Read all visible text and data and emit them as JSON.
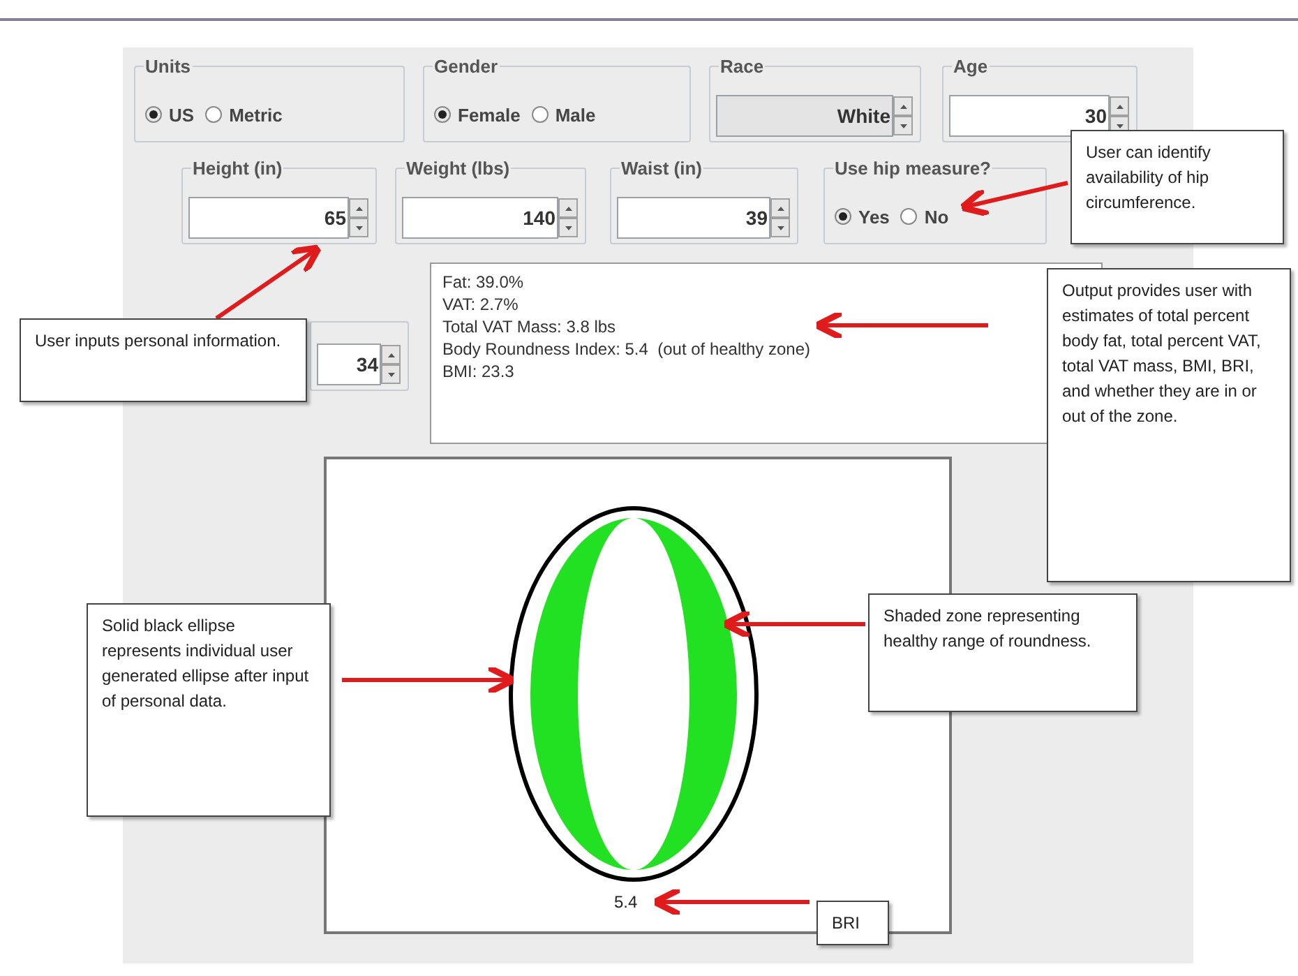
{
  "groups": [
    {
      "kind": "radio",
      "title": "Units",
      "options": [
        {
          "label": "US",
          "selected": true
        },
        {
          "label": "Metric",
          "selected": false
        }
      ]
    },
    {
      "kind": "radio",
      "title": "Gender",
      "options": [
        {
          "label": "Female",
          "selected": true
        },
        {
          "label": "Male",
          "selected": false
        }
      ]
    },
    {
      "kind": "spinner",
      "title": "Race",
      "value": "White",
      "disabled": true
    },
    {
      "kind": "spinner",
      "title": "Age",
      "value": "30",
      "disabled": false
    },
    {
      "kind": "spinner",
      "title": "Height (in)",
      "value": "65",
      "disabled": false
    },
    {
      "kind": "spinner",
      "title": "Weight (lbs)",
      "value": "140",
      "disabled": false
    },
    {
      "kind": "spinner",
      "title": "Waist (in)",
      "value": "39",
      "disabled": false
    },
    {
      "kind": "radio",
      "title": "Use hip measure?",
      "options": [
        {
          "label": "Yes",
          "selected": true
        },
        {
          "label": "No",
          "selected": false
        }
      ]
    },
    {
      "kind": "spinner",
      "value": "34",
      "disabled": false
    }
  ],
  "output": {
    "lines": [
      "Fat: 39.0%",
      "VAT: 2.7%",
      "Total VAT Mass: 3.8 lbs",
      "Body Roundness Index: 5.4  (out of healthy zone)",
      "BMI: 23.3"
    ]
  },
  "canvas": {
    "bri_value": "5.4"
  },
  "callouts": [
    {
      "text": "User can identify availability of hip circumference."
    },
    {
      "text": "User inputs personal information."
    },
    {
      "text": "Output provides user with estimates of total percent body fat, total percent VAT, total VAT mass, BMI, BRI, and whether they are in or out of the zone."
    },
    {
      "text": "Solid black ellipse represents individual user generated ellipse after input of personal data."
    },
    {
      "text": "Shaded zone representing healthy range of roundness."
    },
    {
      "text": "BRI"
    }
  ]
}
